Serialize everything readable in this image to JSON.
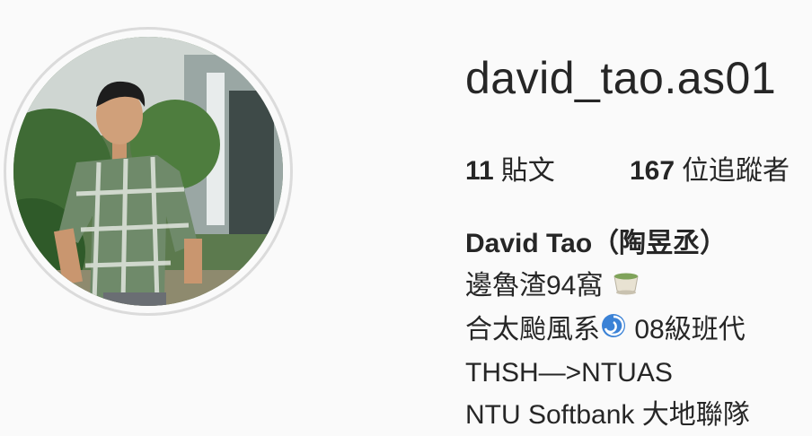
{
  "profile": {
    "username": "david_tao.as01",
    "stats": {
      "posts_count": "11",
      "posts_label": "貼文",
      "followers_count": "167",
      "followers_label": "位追蹤者"
    },
    "bio": {
      "full_name": "David Tao（陶昱丞）",
      "line1": "邊魯渣94窩",
      "line1_emoji": "teacup-icon",
      "line2_a": "合太颱風系",
      "line2_emoji": "cyclone-icon",
      "line2_b": " 08級班代",
      "line3": "THSH—>NTUAS",
      "line4": "NTU Softbank 大地聯隊"
    }
  },
  "colors": {
    "background": "#fafafa",
    "text": "#262626",
    "avatar_ring": "#dbdbdb"
  }
}
